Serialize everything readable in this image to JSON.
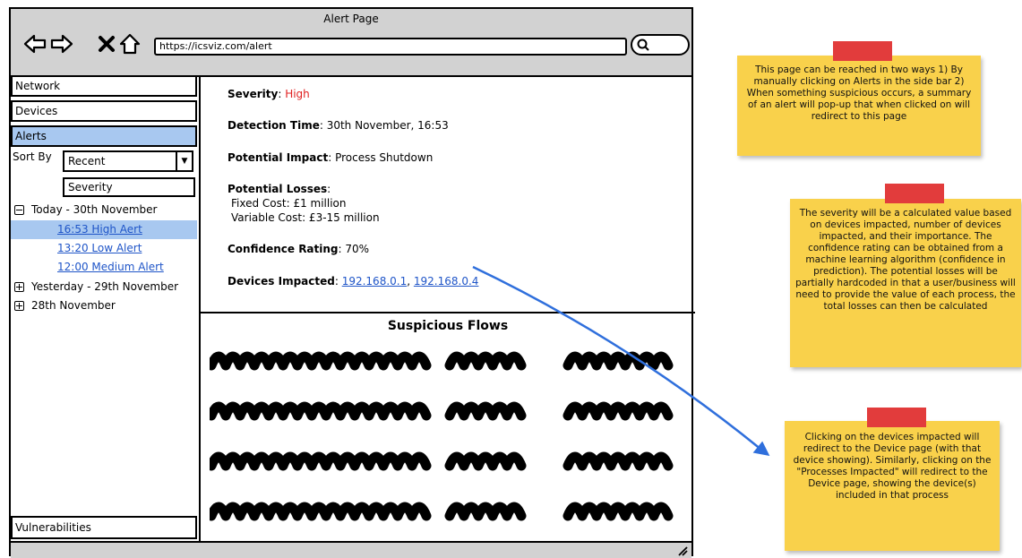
{
  "window": {
    "title": "Alert Page",
    "url": "https://icsviz.com/alert"
  },
  "sidebar": {
    "items": [
      "Network",
      "Devices",
      "Alerts"
    ],
    "sort_label": "Sort By",
    "sort_selected": "Recent",
    "sort_option": "Severity",
    "groups": [
      {
        "label": "Today - 30th November",
        "expanded": true,
        "alerts": [
          "16:53 High Aert",
          "13:20 Low Alert",
          "12:00 Medium Alert"
        ]
      },
      {
        "label": "Yesterday - 29th November",
        "expanded": false
      },
      {
        "label": "28th November",
        "expanded": false
      }
    ],
    "bottom_item": "Vulnerabilities"
  },
  "alert": {
    "severity_label": "Severity",
    "severity_value": "High",
    "detection_label": "Detection Time",
    "detection_value": "30th November, 16:53",
    "impact_label": "Potential Impact",
    "impact_value": "Process Shutdown",
    "losses_label": "Potential Losses",
    "fixed_cost": "Fixed Cost: £1 million",
    "variable_cost": "Variable Cost: £3-15 million",
    "confidence_label": "Confidence Rating",
    "confidence_value": "70%",
    "devices_label": "Devices Impacted",
    "devices": [
      "192.168.0.1",
      "192.168.0.4"
    ]
  },
  "flows": {
    "title": "Suspicious Flows"
  },
  "notes": [
    "This page can be reached in two ways 1) By manually clicking on Alerts in the side bar 2) When something suspicious occurs, a summary of an alert will pop-up that when clicked on will redirect to this page",
    "The severity will be a calculated value based on devices impacted, number of devices impacted, and their importance. The confidence rating can be obtained from a machine learning algorithm (confidence in prediction). The potential losses will be partially hardcoded in that a user/business will need to provide the value of each process, the total losses can then be calculated",
    "Clicking on the devices impacted will redirect to the Device page (with that device showing). Similarly, clicking on the \"Processes Impacted\" will redirect to the Device page, showing the device(s) included in that process"
  ],
  "colors": {
    "accent_red": "#e02020",
    "link_blue": "#1f55c8",
    "highlight": "#a8c8f0",
    "note_yellow": "#f9d14b",
    "tape_red": "#e23c3c",
    "arrow_blue": "#2f6fdc"
  }
}
